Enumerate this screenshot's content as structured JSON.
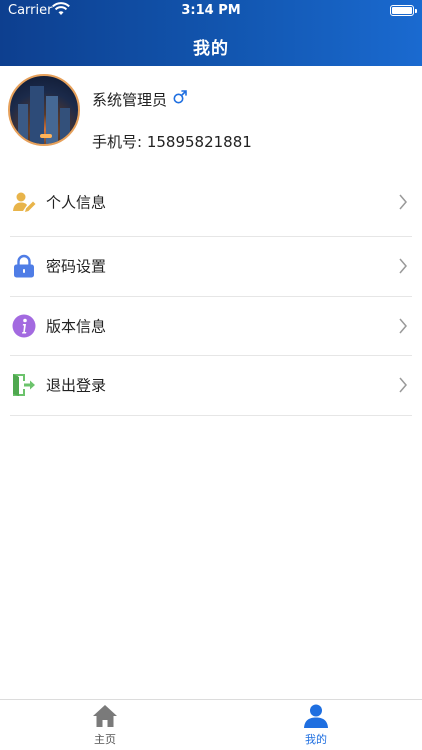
{
  "status_bar": {
    "carrier": "Carrier",
    "time": "3:14 PM"
  },
  "header": {
    "title": "我的"
  },
  "profile": {
    "name": "系统管理员",
    "gender_symbol": "♂",
    "phone": "手机号: 15895821881"
  },
  "menu": [
    {
      "label": "个人信息",
      "icon": "user-edit-icon"
    },
    {
      "label": "密码设置",
      "icon": "lock-icon"
    },
    {
      "label": "版本信息",
      "icon": "info-icon"
    },
    {
      "label": "退出登录",
      "icon": "logout-icon"
    }
  ],
  "tabbar": [
    {
      "label": "主页",
      "icon": "home-icon",
      "active": false
    },
    {
      "label": "我的",
      "icon": "person-icon",
      "active": true
    }
  ],
  "colors": {
    "header_start": "#0d3f8f",
    "header_end": "#1a6ad0",
    "active_tab": "#1f6fe0",
    "inactive_tab": "#7a7a7a"
  }
}
